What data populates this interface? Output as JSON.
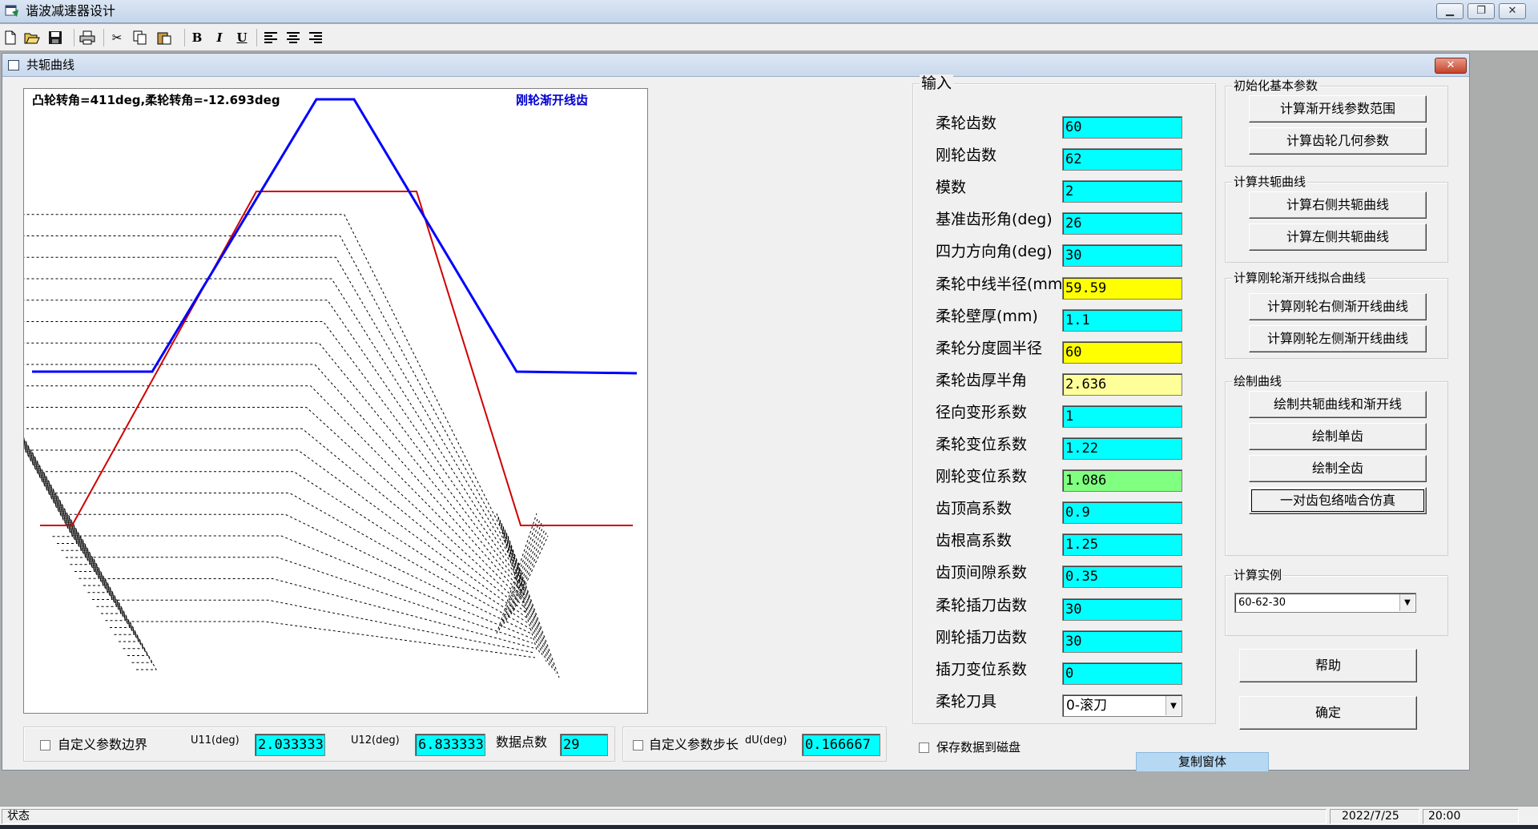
{
  "window": {
    "title": "谐波减速器设计"
  },
  "child": {
    "title": "共轭曲线"
  },
  "plot": {
    "caption_left": "凸轮转角=411deg,柔轮转角=-12.693deg",
    "caption_right": "刚轮渐开线齿"
  },
  "colors": {
    "cyan": "#00ffff",
    "yellow": "#ffff00",
    "light_yellow": "#ffff99",
    "green": "#80ff80",
    "involute_blue": "#0000ff",
    "conjugate_red": "#d00000"
  },
  "bottom_bar": {
    "custom_bounds_label": "自定义参数边界",
    "u11_label": "U11(deg)",
    "u11_value": "2.033333",
    "u12_label": "U12(deg)",
    "u12_value": "6.833333",
    "points_label": "数据点数",
    "points_value": "29",
    "custom_step_label": "自定义参数步长",
    "du_label": "dU(deg)",
    "du_value": "0.166667",
    "save_disk_label": "保存数据到磁盘"
  },
  "input": {
    "group_label": "输入",
    "rows": [
      {
        "label": "柔轮齿数",
        "value": "60"
      },
      {
        "label": "刚轮齿数",
        "value": "62"
      },
      {
        "label": "模数",
        "value": "2"
      },
      {
        "label": "基准齿形角(deg)",
        "value": "26"
      },
      {
        "label": "四力方向角(deg)",
        "value": "30"
      },
      {
        "label": "柔轮中线半径(mm)",
        "value": "59.59"
      },
      {
        "label": "柔轮壁厚(mm)",
        "value": "1.1"
      },
      {
        "label": "柔轮分度圆半径",
        "value": "60"
      },
      {
        "label": "柔轮齿厚半角",
        "value": "2.636"
      },
      {
        "label": "径向变形系数",
        "value": "1"
      },
      {
        "label": "柔轮变位系数",
        "value": "1.22"
      },
      {
        "label": "刚轮变位系数",
        "value": "1.086"
      },
      {
        "label": "齿顶高系数",
        "value": "0.9"
      },
      {
        "label": "齿根高系数",
        "value": "1.25"
      },
      {
        "label": "齿顶间隙系数",
        "value": "0.35"
      },
      {
        "label": "柔轮插刀齿数",
        "value": "30"
      },
      {
        "label": "刚轮插刀齿数",
        "value": "30"
      },
      {
        "label": "插刀变位系数",
        "value": "0"
      }
    ],
    "tool_label": "柔轮刀具",
    "tool_value": "0-滚刀"
  },
  "groups": {
    "init": {
      "label": "初始化基本参数",
      "btn1": "计算渐开线参数范围",
      "btn2": "计算齿轮几何参数"
    },
    "conj": {
      "label": "计算共轭曲线",
      "btn1": "计算右侧共轭曲线",
      "btn2": "计算左侧共轭曲线"
    },
    "fit": {
      "label": "计算刚轮渐开线拟合曲线",
      "btn1": "计算刚轮右侧渐开线曲线",
      "btn2": "计算刚轮左侧渐开线曲线"
    },
    "draw": {
      "label": "绘制曲线",
      "btn1": "绘制共轭曲线和渐开线",
      "btn2": "绘制单齿",
      "btn3": "绘制全齿",
      "btn4": "一对齿包络啮合仿真"
    },
    "example": {
      "label": "计算实例",
      "value": "60-62-30"
    }
  },
  "buttons": {
    "help": "帮助",
    "ok": "确定",
    "copy_window": "复制窗体"
  },
  "status": {
    "text": "状态",
    "date": "2022/7/25",
    "time": "20:00"
  },
  "icons": {
    "new": "new-file-icon",
    "open": "open-folder-icon",
    "save": "save-icon",
    "print": "print-icon",
    "cut": "cut-icon",
    "copy": "copy-icon",
    "paste": "paste-icon",
    "bold": "bold-icon",
    "italic": "italic-icon",
    "underline": "underline-icon",
    "align_left": "align-left-icon",
    "align_center": "align-center-icon",
    "align_right": "align-right-icon"
  }
}
